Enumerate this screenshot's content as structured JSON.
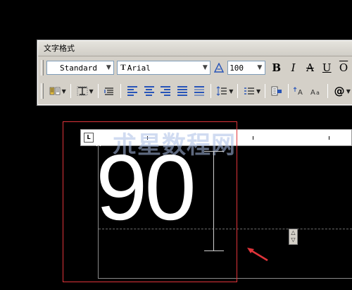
{
  "toolbar": {
    "title": "文字格式",
    "style_value": "Standard",
    "font_badge": "T",
    "font_value": "Arial",
    "height_value": "100",
    "bold_label": "B",
    "italic_label": "I",
    "strike_label": "A",
    "underline_label": "U",
    "overline_label": "O"
  },
  "ruler": {
    "indent_marker": "L"
  },
  "watermark": "朮星数程网",
  "editor": {
    "text": "90"
  },
  "colors": {
    "annotation": "#e0343a",
    "background": "#000000"
  }
}
